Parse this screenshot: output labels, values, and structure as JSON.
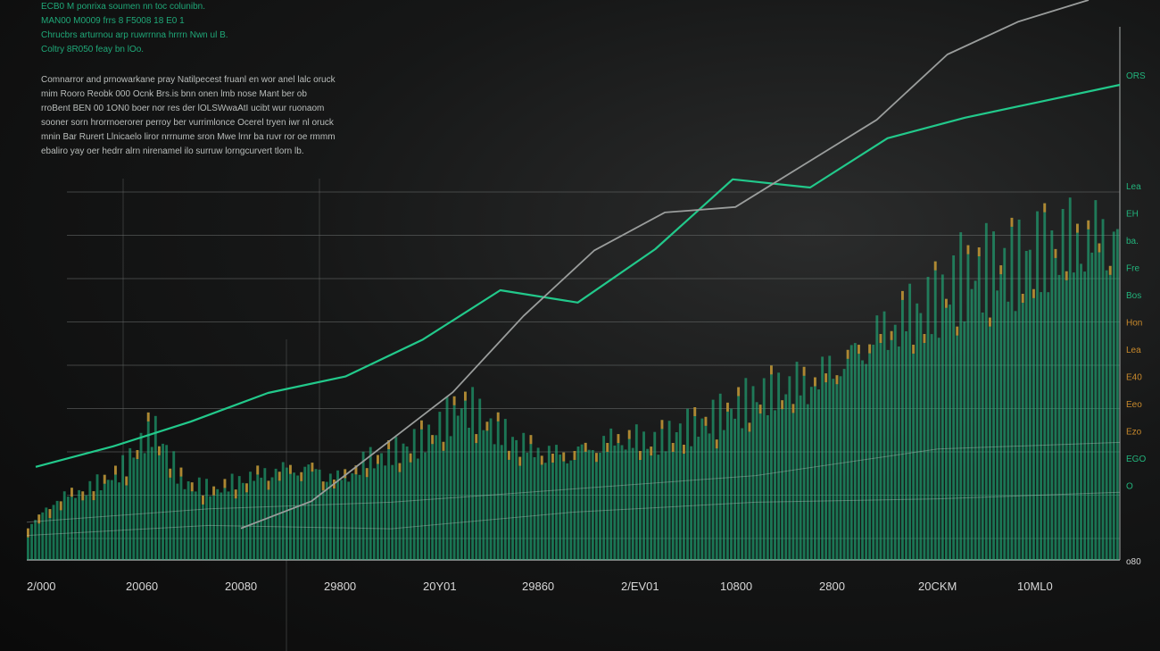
{
  "header": {
    "lines_green": [
      "ECB0 M ponrixa soumen nn toc colunibn.",
      "MAN00 M0009 frrs 8 F5008 18 E0 1",
      "Chrucbrs arturnou arp ruwrrnna hrrrn Nwn ul B.",
      "Coltry 8R050 feay bn lOo."
    ],
    "lines_white": [
      "Comnarror and prnowarkane pray Natilpecest fruanl en wor anel lalc oruck",
      "mim Rooro Reobk 000 Ocnk Brs.is bnn onen lmb nose Mant ber ob",
      "rroBent BEN 00 1ON0 boer nor res der lOLSWwaAtI ucibt wur ruonaom",
      "sooner sorn hrorrnoerorer perroy ber vurrimlonce Ocerel tryen iwr nl oruck",
      "mnin Bar Rurert Llnicaelo liror nrrnume sron Mwe lrnr ba ruvr ror oe rmmm.",
      "ebaliro yay oer hedrr alrn nirenamel ilo surruw lorngcurvert tlorn lb."
    ]
  },
  "chart_data": {
    "type": "bar",
    "title": "",
    "xlabel": "",
    "ylabel": "",
    "x_tick_labels": [
      "2/000",
      "20060",
      "20080",
      "29800",
      "20Y01",
      "29860",
      "2/EV01",
      "10800",
      "2800",
      "20CKM",
      "10ML0"
    ],
    "right_tick_labels": [
      "ORS",
      "Lea",
      "EH",
      "ba.",
      "Fre",
      "Bos",
      "Hon",
      "Lea",
      "E40",
      "Eeo",
      "Ezo",
      "EGO",
      "O",
      "o80"
    ],
    "colors": {
      "bars": "#1fb67f",
      "bar_tips": "#c98a2c",
      "green_line": "#22c98b",
      "gray_line": "#9a9d9c",
      "grid": "#6a6d6c",
      "tick_text": "#d7d7d7",
      "right_text": "#22b47c"
    },
    "bar_values": [
      0.05,
      0.14,
      0.17,
      0.22,
      0.35,
      0.18,
      0.16,
      0.2,
      0.23,
      0.24,
      0.2,
      0.26,
      0.28,
      0.33,
      0.42,
      0.35,
      0.3,
      0.28,
      0.3,
      0.33,
      0.31,
      0.34,
      0.37,
      0.42,
      0.47,
      0.5,
      0.56,
      0.64,
      0.7,
      0.73,
      0.8,
      0.82,
      0.85,
      0.92,
      0.95,
      1.0
    ],
    "green_line": [
      0.07,
      0.12,
      0.18,
      0.25,
      0.29,
      0.38,
      0.5,
      0.47,
      0.6,
      0.77,
      0.75,
      0.87,
      0.92,
      0.96,
      1.0
    ],
    "gray_line": [
      0.03,
      0.08,
      0.18,
      0.28,
      0.42,
      0.54,
      0.61,
      0.62,
      0.7,
      0.78,
      0.9,
      0.96,
      1.0
    ],
    "ylim": [
      0,
      1
    ]
  }
}
